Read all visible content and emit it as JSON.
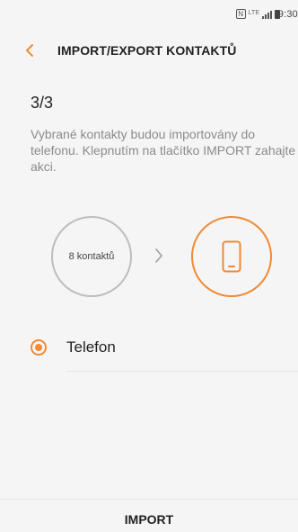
{
  "status_bar": {
    "time": "9:30",
    "nfc_glyph": "N",
    "network": "LTE",
    "icons": [
      "nfc-icon",
      "lte-icon",
      "signal-icon",
      "battery-icon"
    ]
  },
  "header": {
    "title": "IMPORT/EXPORT KONTAKTŮ",
    "back_icon": "chevron-left-icon"
  },
  "step": "3/3",
  "description": "Vybrané kontakty budou importovány do telefonu. Klepnutím na tlačítko IMPORT zahajte akci.",
  "graphic": {
    "source_label": "8 kontaktů",
    "arrow_icon": "chevron-right-icon",
    "target_icon": "phone-icon"
  },
  "option": {
    "label": "Telefon",
    "selected": true
  },
  "bottom": {
    "import_label": "IMPORT"
  },
  "colors": {
    "accent": "#f08a34",
    "text": "#222222",
    "muted": "#8b8b8b",
    "background": "#f5f5f5"
  }
}
